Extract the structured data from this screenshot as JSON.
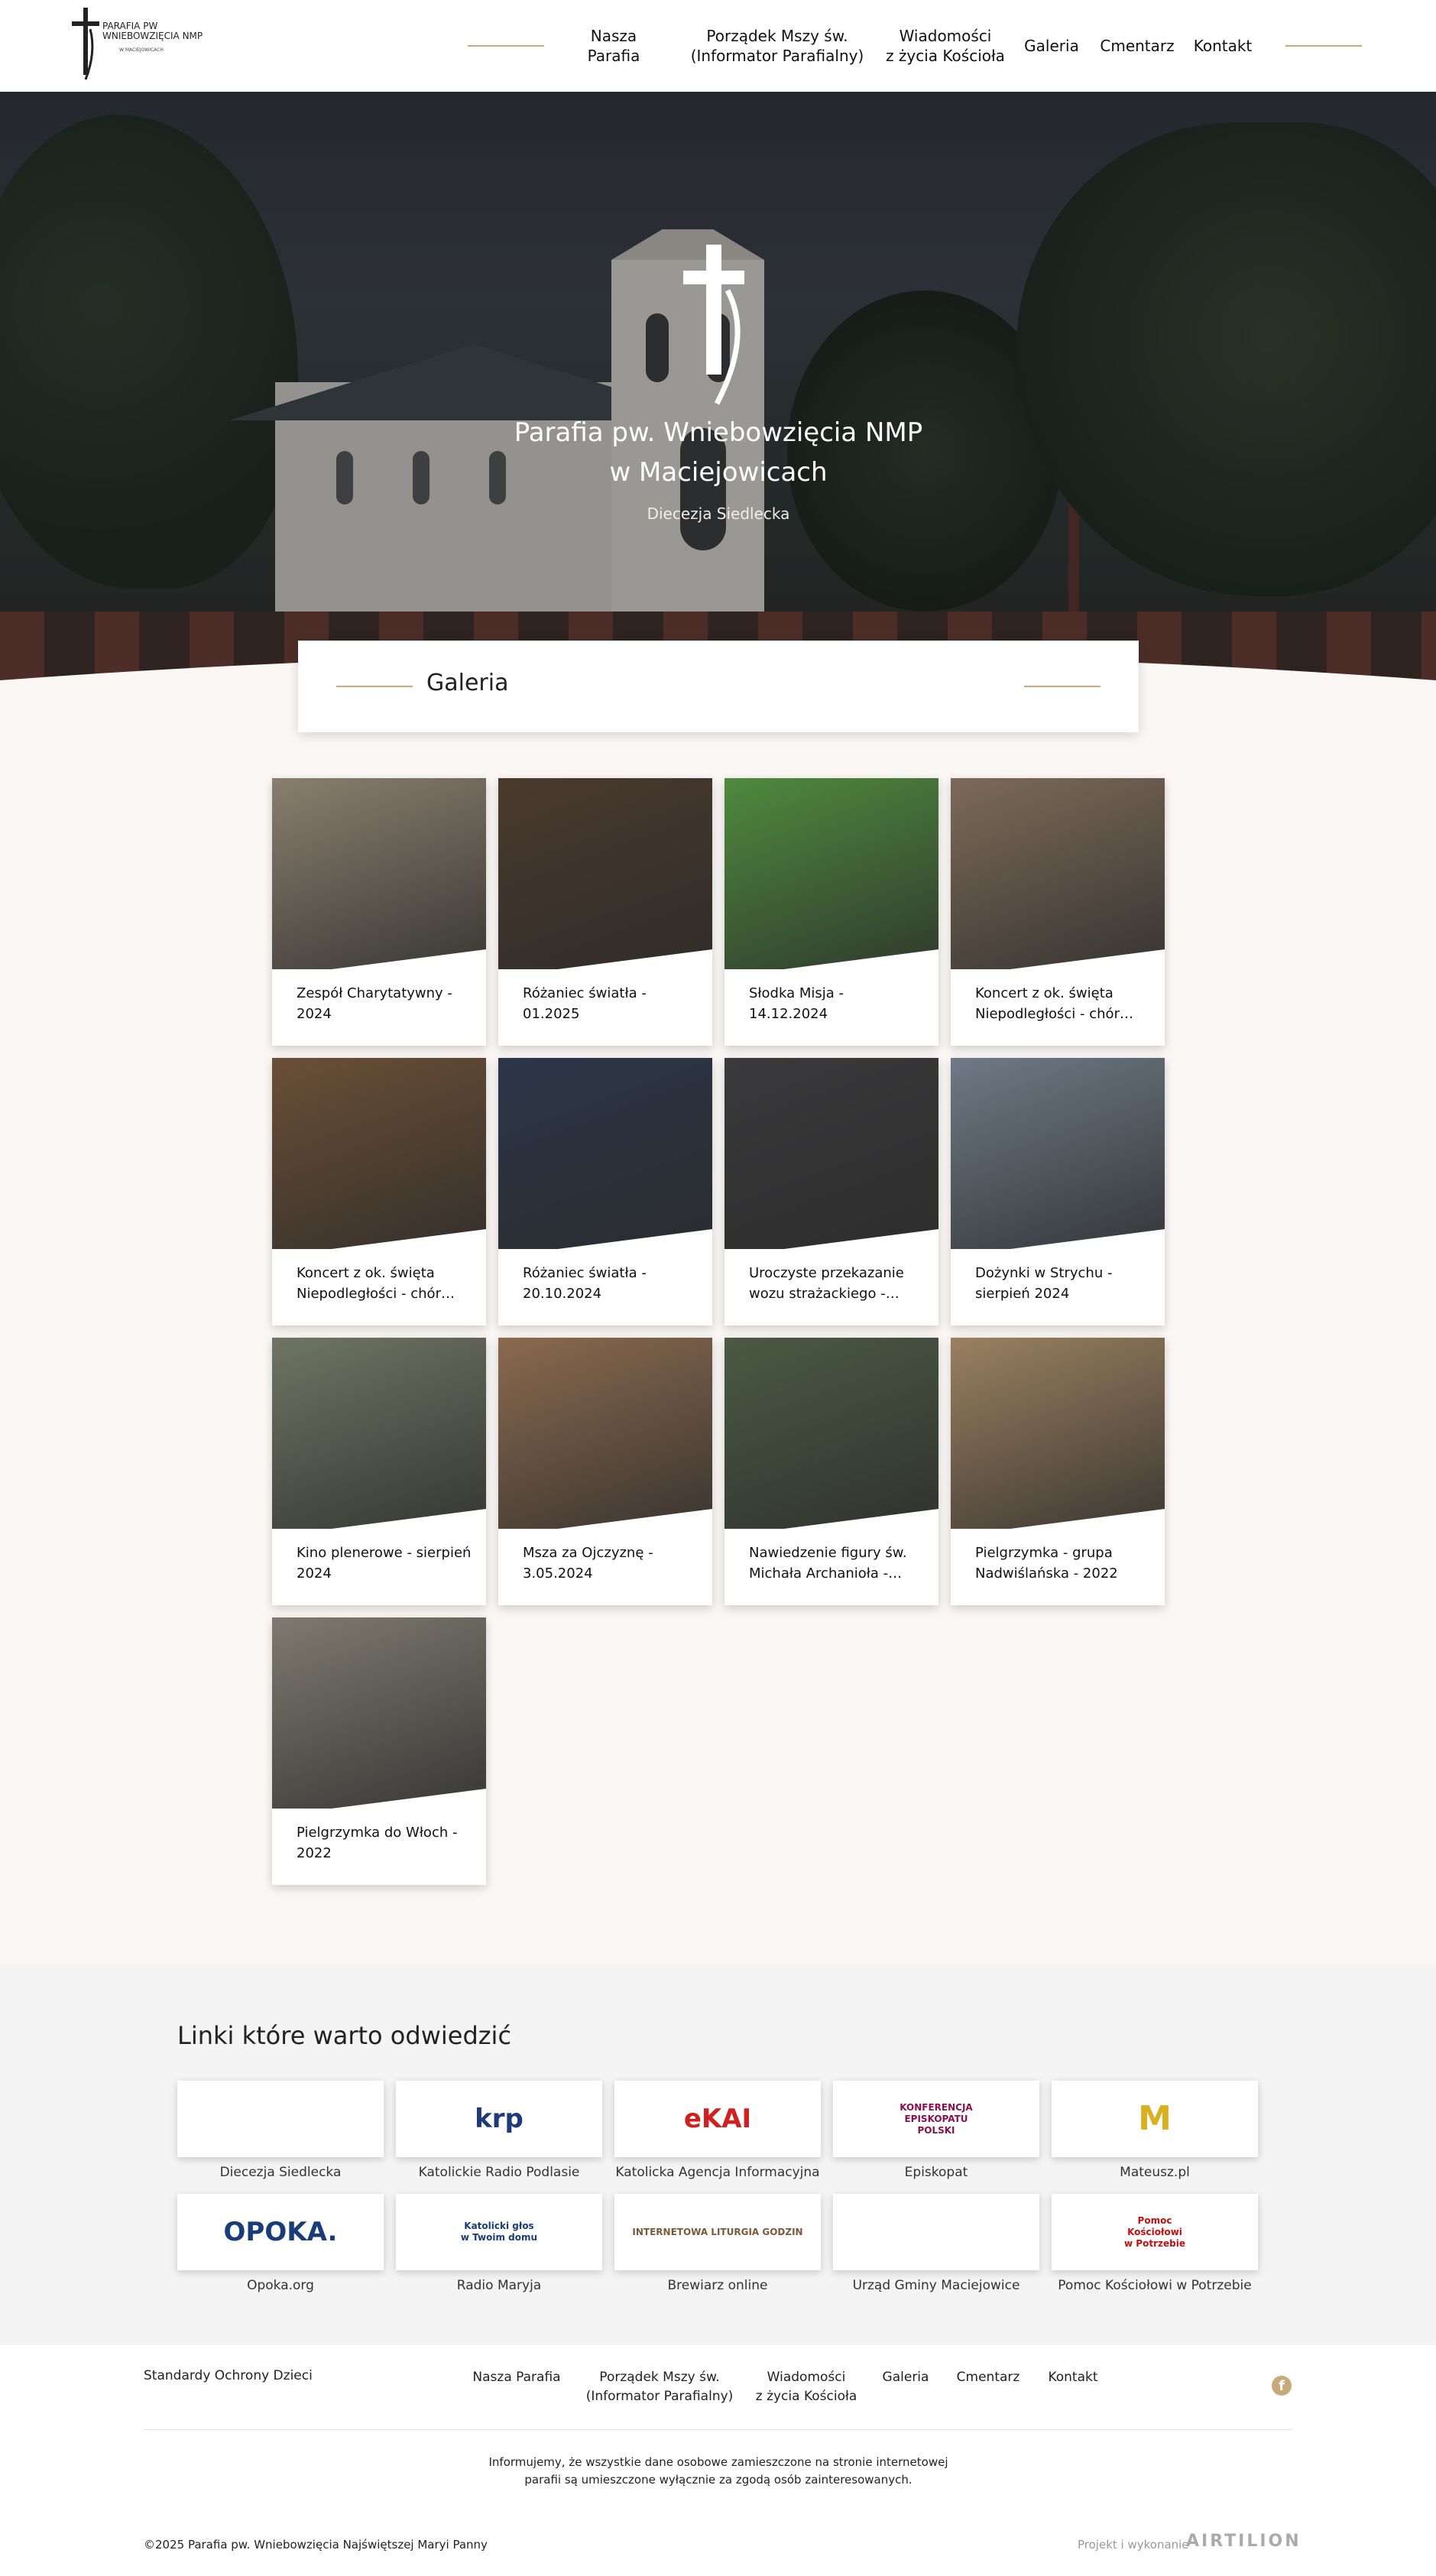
{
  "header": {
    "logo_text": "PARAFIA PW\nWNIEBOWZIĘCIA NMP",
    "logo_sub": "W MACIEJOWICACH",
    "nav": [
      {
        "label": "Nasza Parafia"
      },
      {
        "label": "Porządek Mszy św.\n(Informator Parafialny)"
      },
      {
        "label": "Wiadomości\nz życia Kościoła"
      },
      {
        "label": "Galeria"
      },
      {
        "label": "Cmentarz"
      },
      {
        "label": "Kontakt"
      }
    ]
  },
  "hero": {
    "title": "Parafia pw. Wniebowzięcia NMP\nw Maciejowicach",
    "subtitle": "Diecezja Siedlecka"
  },
  "section": {
    "title": "Galeria"
  },
  "gallery": [
    {
      "title": "Zespół Charytatywny - 2024",
      "color": "#8a7f6e"
    },
    {
      "title": "Różaniec światła - 01.2025",
      "color": "#4a3a2c"
    },
    {
      "title": "Słodka Misja - 14.12.2024",
      "color": "#4f8a3e"
    },
    {
      "title": "Koncert z ok. święta Niepodległości - chór…",
      "color": "#7c6a58"
    },
    {
      "title": "Koncert z ok. święta Niepodległości - chór…",
      "color": "#6a4f36"
    },
    {
      "title": "Różaniec światła - 20.10.2024",
      "color": "#2c3648"
    },
    {
      "title": "Uroczyste przekazanie wozu strażackiego -…",
      "color": "#3a3a3c"
    },
    {
      "title": "Dożynki w Strychu - sierpień 2024",
      "color": "#6e7a86"
    },
    {
      "title": "Kino plenerowe - sierpień 2024",
      "color": "#6f7563"
    },
    {
      "title": "Msza za Ojczyznę - 3.05.2024",
      "color": "#8a6a4f"
    },
    {
      "title": "Nawiedzenie figury św. Michała Archanioła -…",
      "color": "#4b5a44"
    },
    {
      "title": "Pielgrzymka - grupa Nadwiślańska - 2022",
      "color": "#9a8060"
    },
    {
      "title": "Pielgrzymka do Włoch - 2022",
      "color": "#7e7a70"
    }
  ],
  "links": {
    "title": "Linki które warto odwiedzić",
    "items": [
      {
        "label": "Diecezja Siedlecka",
        "logo": "",
        "color": "#222222"
      },
      {
        "label": "Katolickie Radio Podlasie",
        "logo": "krp",
        "color": "#1f3a7a"
      },
      {
        "label": "Katolicka Agencja Informacyjna",
        "logo": "eKAI",
        "color": "#d02020"
      },
      {
        "label": "Episkopat",
        "logo": "KONFERENCJA\nEPISKOPATU\nPOLSKI",
        "color": "#8a1050"
      },
      {
        "label": "Mateusz.pl",
        "logo": "M",
        "color": "#d9b020"
      },
      {
        "label": "Opoka.org",
        "logo": "OPOKA.",
        "color": "#1a3d7a"
      },
      {
        "label": "Radio Maryja",
        "logo": "Katolicki głos\nw Twoim domu",
        "color": "#1a3d7a"
      },
      {
        "label": "Brewiarz online",
        "logo": "INTERNETOWA LITURGIA GODZIN",
        "color": "#7a5a3a"
      },
      {
        "label": "Urząd Gminy Maciejowice",
        "logo": "",
        "color": "#d02020"
      },
      {
        "label": "Pomoc Kościołowi w Potrzebie",
        "logo": "Pomoc\nKościołowi\nw Potrzebie",
        "color": "#c01010"
      }
    ]
  },
  "footer": {
    "standards": "Standardy Ochrony Dzieci",
    "nav": [
      {
        "label": "Nasza Parafia"
      },
      {
        "label": "Porządek Mszy św.\n(Informator Parafialny)"
      },
      {
        "label": "Wiadomości\nz życia Kościoła"
      },
      {
        "label": "Galeria"
      },
      {
        "label": "Cmentarz"
      },
      {
        "label": "Kontakt"
      }
    ],
    "info": "Informujemy, że wszystkie dane osobowe zamieszczone na stronie internetowej\nparafii są umieszczone wyłącznie za zgodą osób zainteresowanych.",
    "copyright": "©2025 Parafia pw. Wniebowzięcia Najświętszej Maryi Panny",
    "project": "Projekt i wykonanie",
    "brand": "AIRTILION"
  },
  "colors": {
    "accent": "#c8a97a",
    "background": "#faf7f4"
  }
}
